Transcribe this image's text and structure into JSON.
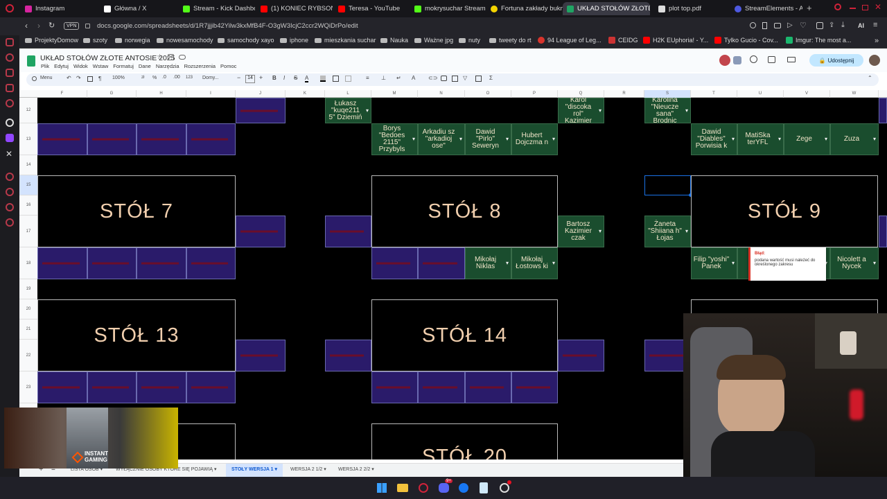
{
  "browser": {
    "tabs": [
      {
        "label": "Instagram",
        "color": "#d6249f"
      },
      {
        "label": "Główna / X",
        "color": "#ffffff"
      },
      {
        "label": "Stream - Kick Dashbo",
        "color": "#53fc18"
      },
      {
        "label": "(1) KONIEC RYBSON A",
        "color": "#ff0000"
      },
      {
        "label": "Teresa - YouTube",
        "color": "#ff0000"
      },
      {
        "label": "mokrysuchar Stream",
        "color": "#53fc18"
      },
      {
        "label": "Fortuna zakłady bukm",
        "color": "#f4d400"
      },
      {
        "label": "UKŁAD STOŁÓW ZŁOTE A",
        "color": "#1fa463",
        "active": true
      },
      {
        "label": "plot top.pdf",
        "color": "#dddddd"
      },
      {
        "label": "StreamElements - Acti",
        "color": "#4e59e0"
      }
    ],
    "vpn_label": "VPN",
    "url": "docs.google.com/spreadsheets/d/1R7jjjib42Yilw3kxMfB4F-O3gW3IcjC2ccr2WQiDrPo/edit",
    "ai_label": "AI",
    "bookmarks": [
      "ProjektyDomow",
      "szoty",
      "norwegia",
      "nowesamochody",
      "samochody xayo",
      "iphone",
      "mieszkania suchar",
      "Nauka",
      "Ważne jpg",
      "nuty",
      "tweety do rt",
      "94 League of Leg...",
      "CEIDG",
      "H2K EUphoria! - Y...",
      "Tylko Gucio - Cov...",
      "Imgur: The most a..."
    ]
  },
  "sheets": {
    "doc_title": "UKŁAD STOŁÓW ZŁOTE ANTOSIE 2025",
    "menu": [
      "Plik",
      "Edytuj",
      "Widok",
      "Wstaw",
      "Formatuj",
      "Dane",
      "Narzędzia",
      "Rozszerzenia",
      "Pomoc"
    ],
    "share_label": "Udostępnij",
    "toolbar": {
      "menu_label": "Menu",
      "zoom": "100%",
      "currency_label": "zł",
      "percent_label": "%",
      "format_123": "123",
      "font": "Domy...",
      "font_size": "14"
    },
    "columns": [
      "F",
      "G",
      "H",
      "I",
      "J",
      "K",
      "L",
      "M",
      "N",
      "O",
      "P",
      "Q",
      "R",
      "S",
      "T",
      "U",
      "V",
      "W"
    ],
    "rows": [
      "12",
      "13",
      "14",
      "15",
      "16",
      "17",
      "18",
      "19",
      "20",
      "21",
      "22",
      "23"
    ],
    "tables": [
      {
        "label": "STÓŁ 7"
      },
      {
        "label": "STÓŁ 8"
      },
      {
        "label": "STÓŁ 9"
      },
      {
        "label": "STÓŁ 13"
      },
      {
        "label": "STÓŁ 14"
      },
      {
        "label": "STÓŁ 20"
      }
    ],
    "names": [
      {
        "text": "Łukasz \"kuqe211 5\" Dziemiń"
      },
      {
        "text": "Karol \"discoka rol\" Kazimier"
      },
      {
        "text": "Karolina \"Nieucze sana\" Brodnic"
      },
      {
        "text": "Borys \"Bedoes 2115\" Przybyls"
      },
      {
        "text": "Arkadiu sz \"arkadioj ose\""
      },
      {
        "text": "Dawid \"Pirlo\" Seweryn"
      },
      {
        "text": "Hubert Dojczma n"
      },
      {
        "text": "Dawid \"Diables\" Porwisia k"
      },
      {
        "text": "MatiSka terYFL"
      },
      {
        "text": "Zege"
      },
      {
        "text": "Zuza"
      },
      {
        "text": "Bartosz Kazimier czak"
      },
      {
        "text": "Żaneta \"Shiiana h\" Łojas"
      },
      {
        "text": "Mikołaj Niklas"
      },
      {
        "text": "Mikołaj Łostows ki"
      },
      {
        "text": "Filip \"yoshi\" Panek"
      },
      {
        "text": "Nicolett a Nycek"
      }
    ],
    "error_popup": {
      "title": "Błąd:",
      "message": "podana wartość musi należeć do określonego zakresu"
    },
    "sheet_tabs": [
      "LISTA OSÓB",
      "WYŁĄCZNIE OSOBY KTÓRE SIĘ POJAWIĄ",
      "STOŁY WERSJA 1",
      "WERSJA 2 1/2",
      "WERSJA 2 2/2"
    ],
    "active_sheet": "STOŁY WERSJA 1"
  },
  "overlay": {
    "ad_label": "INSTANT GAMING"
  },
  "taskbar": {
    "notification_count": "9+"
  }
}
